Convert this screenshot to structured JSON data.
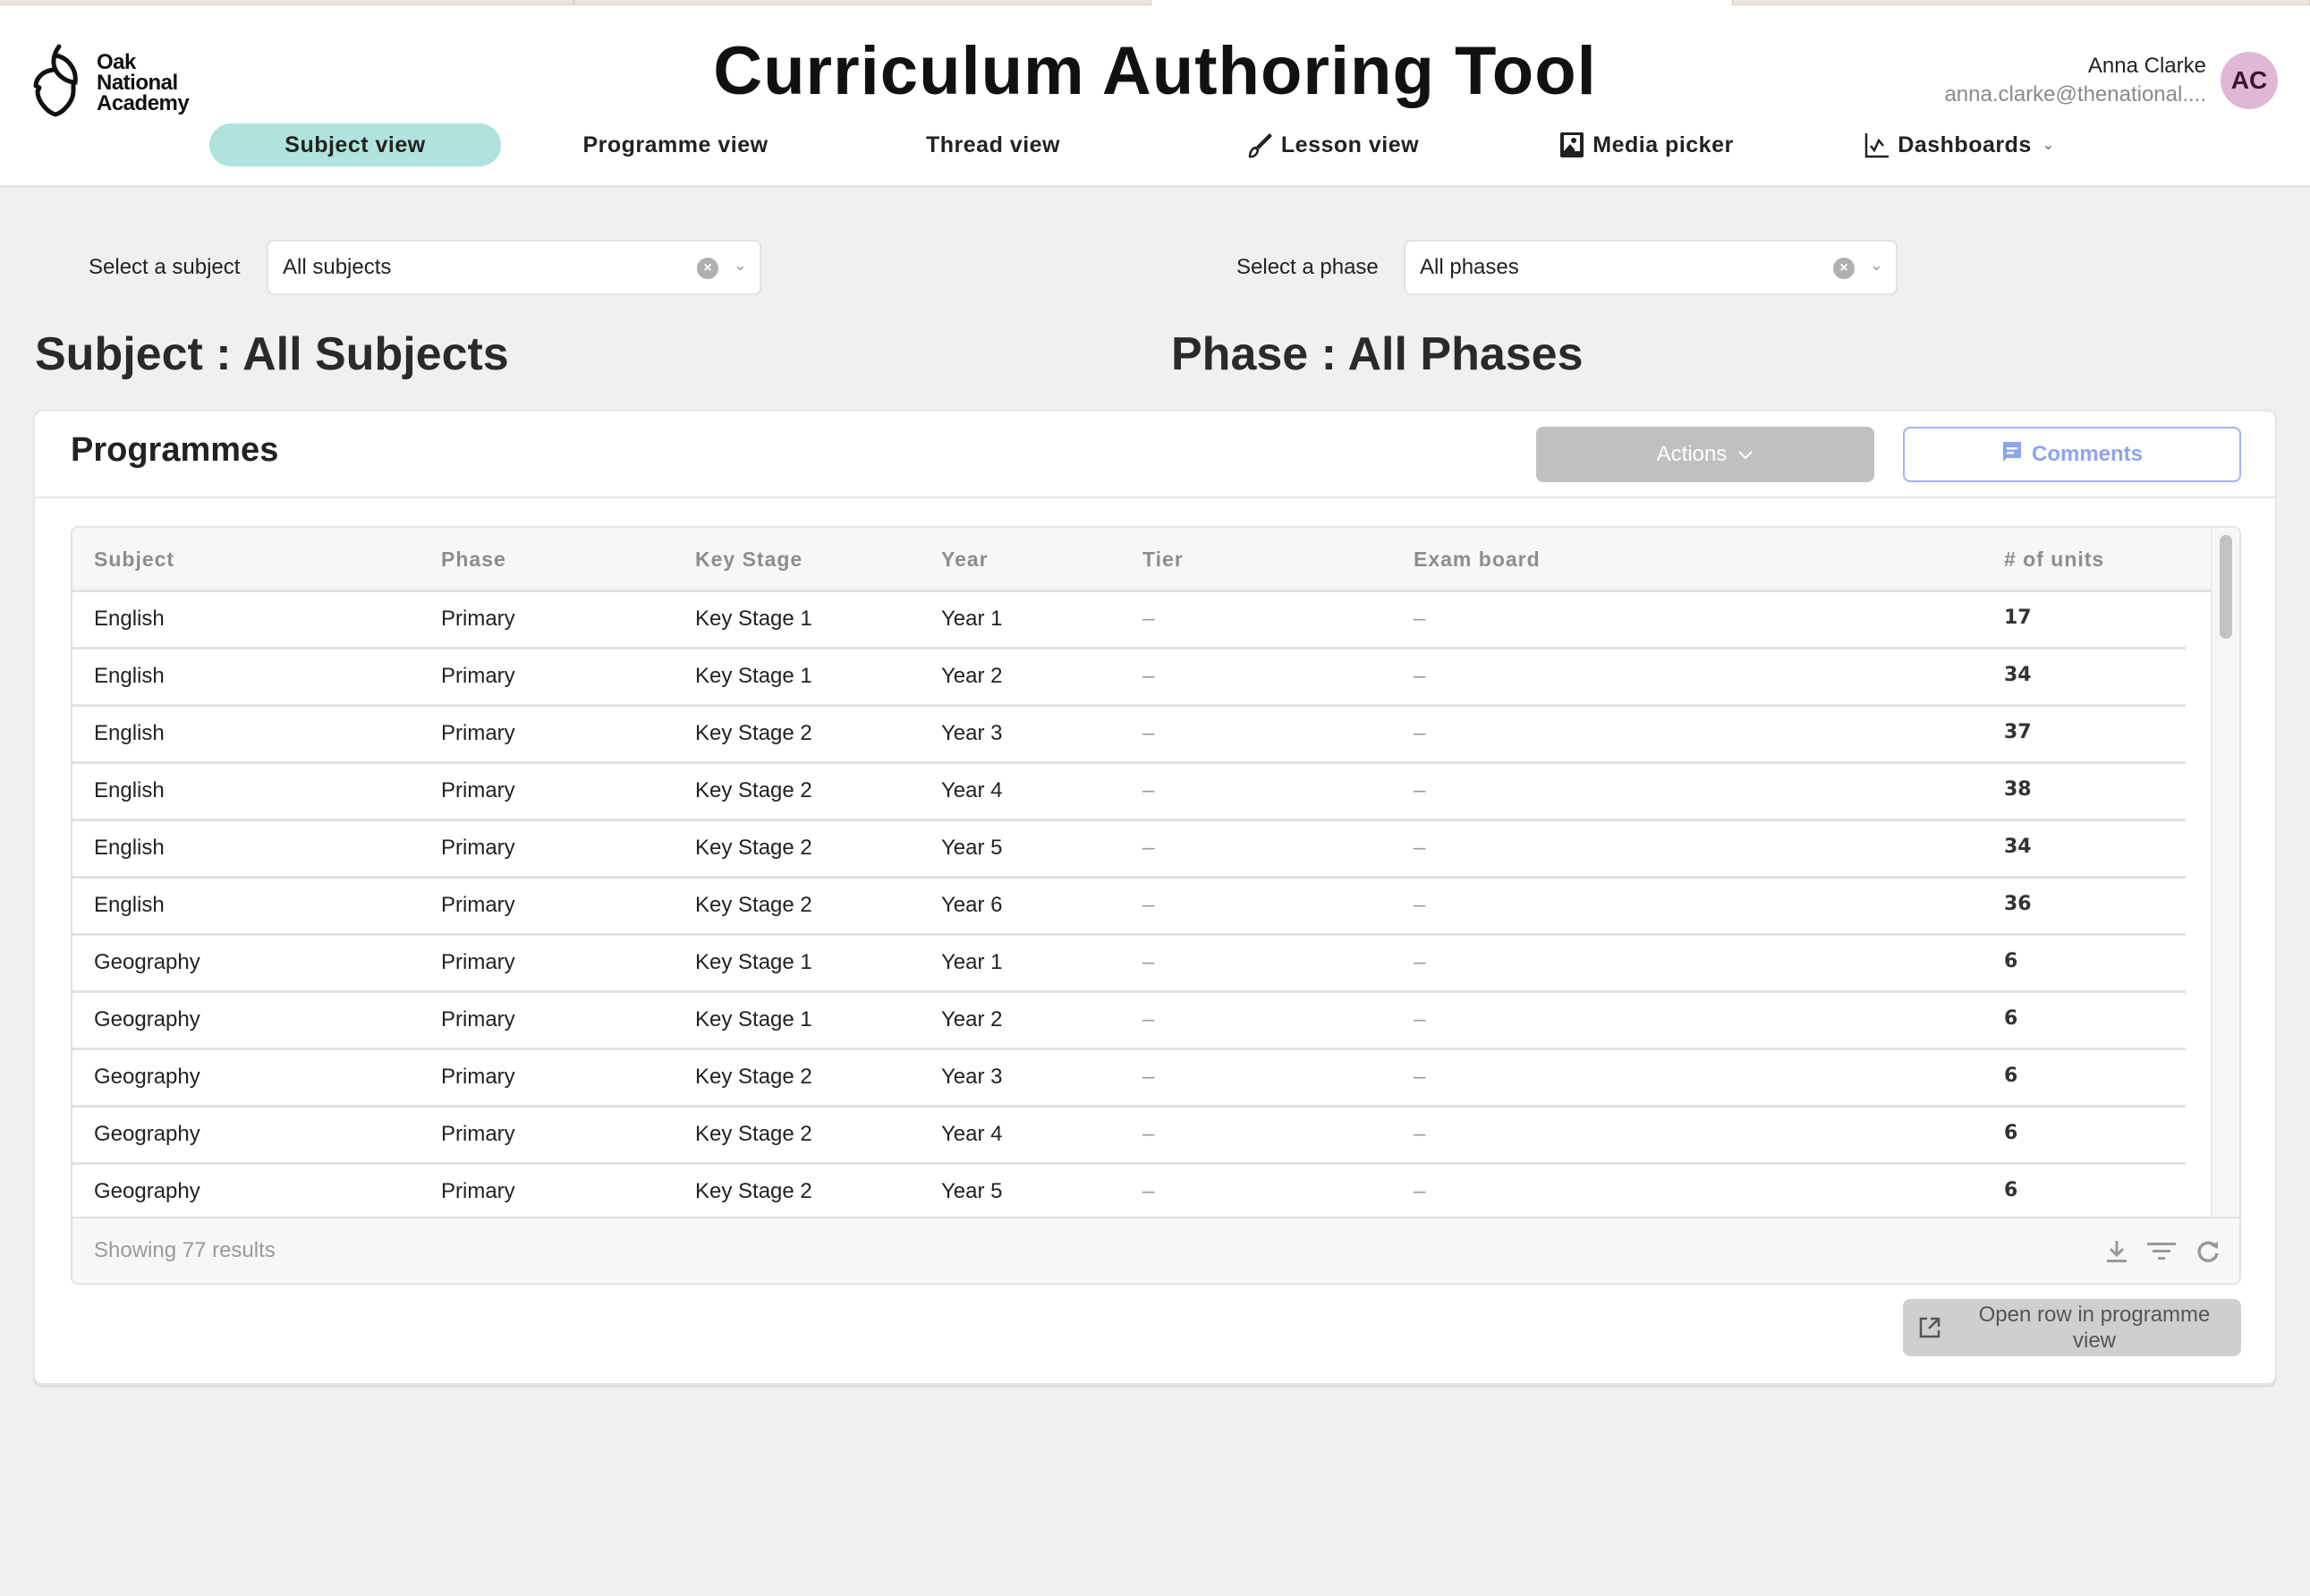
{
  "app": {
    "title": "Curriculum Authoring Tool",
    "logo_lines": [
      "Oak",
      "National",
      "Academy"
    ]
  },
  "user": {
    "name": "Anna Clarke",
    "email": "anna.clarke@thenational....",
    "initials": "AC"
  },
  "nav": {
    "items": [
      {
        "label": "Subject view",
        "icon": "none",
        "active": true
      },
      {
        "label": "Programme view",
        "icon": "none",
        "active": false
      },
      {
        "label": "Thread view",
        "icon": "none",
        "active": false
      },
      {
        "label": "Lesson view",
        "icon": "brush-icon",
        "active": false
      },
      {
        "label": "Media picker",
        "icon": "image-icon",
        "active": false
      },
      {
        "label": "Dashboards",
        "icon": "chart-icon",
        "active": false,
        "has_dropdown": true
      }
    ]
  },
  "filters": {
    "subject": {
      "label": "Select a subject",
      "value": "All subjects"
    },
    "phase": {
      "label": "Select a phase",
      "value": "All phases"
    }
  },
  "headings": {
    "subject": "Subject : All Subjects",
    "phase": "Phase : All Phases"
  },
  "programmes": {
    "title": "Programmes",
    "actions_label": "Actions",
    "comments_label": "Comments",
    "columns": [
      "Subject",
      "Phase",
      "Key Stage",
      "Year",
      "Tier",
      "Exam board",
      "# of units"
    ],
    "rows": [
      [
        "English",
        "Primary",
        "Key Stage 1",
        "Year 1",
        "–",
        "–",
        "17"
      ],
      [
        "English",
        "Primary",
        "Key Stage 1",
        "Year 2",
        "–",
        "–",
        "34"
      ],
      [
        "English",
        "Primary",
        "Key Stage 2",
        "Year 3",
        "–",
        "–",
        "37"
      ],
      [
        "English",
        "Primary",
        "Key Stage 2",
        "Year 4",
        "–",
        "–",
        "38"
      ],
      [
        "English",
        "Primary",
        "Key Stage 2",
        "Year 5",
        "–",
        "–",
        "34"
      ],
      [
        "English",
        "Primary",
        "Key Stage 2",
        "Year 6",
        "–",
        "–",
        "36"
      ],
      [
        "Geography",
        "Primary",
        "Key Stage 1",
        "Year 1",
        "–",
        "–",
        "6"
      ],
      [
        "Geography",
        "Primary",
        "Key Stage 1",
        "Year 2",
        "–",
        "–",
        "6"
      ],
      [
        "Geography",
        "Primary",
        "Key Stage 2",
        "Year 3",
        "–",
        "–",
        "6"
      ],
      [
        "Geography",
        "Primary",
        "Key Stage 2",
        "Year 4",
        "–",
        "–",
        "6"
      ],
      [
        "Geography",
        "Primary",
        "Key Stage 2",
        "Year 5",
        "–",
        "–",
        "6"
      ]
    ],
    "results_text": "Showing 77 results",
    "open_row_label": "Open row in programme view"
  },
  "colors": {
    "active_tab": "#b0e3de",
    "avatar": "#deb8d4",
    "comments_accent": "#8ea4ef",
    "disabled_button": "#c0c0c0"
  }
}
